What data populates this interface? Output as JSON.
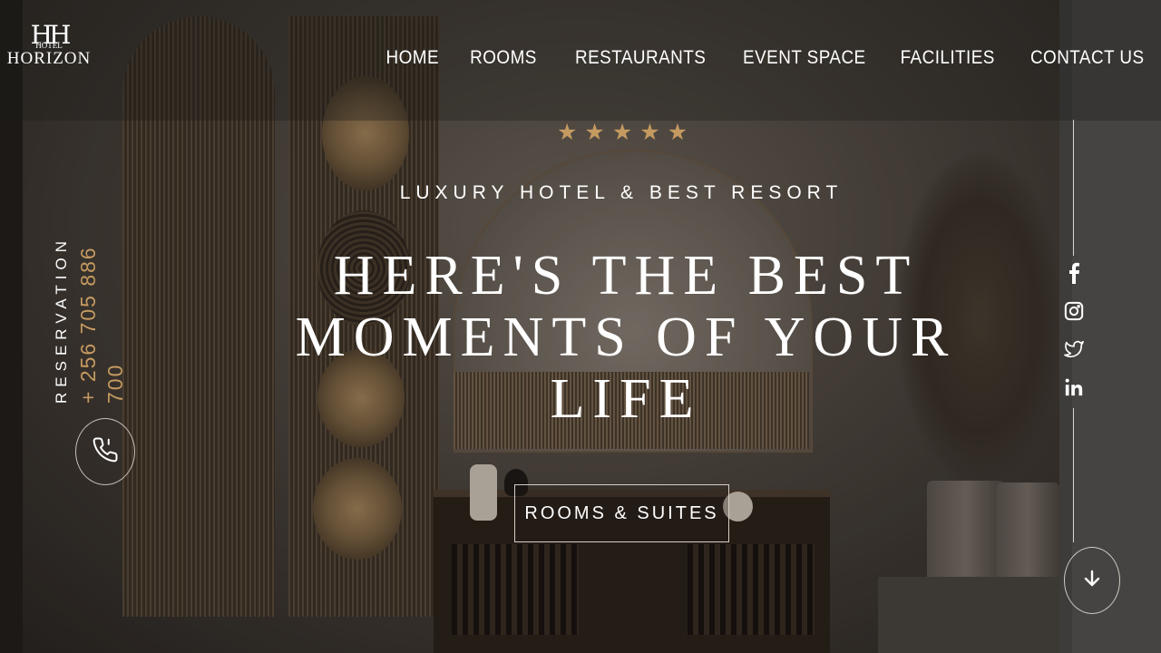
{
  "brand": {
    "mark": "H",
    "small_text": "HOTEL",
    "name": "HORIZON"
  },
  "nav": {
    "items": [
      "HOME",
      "ROOMS",
      "RESTAURANTS",
      "EVENT SPACE",
      "FACILITIES",
      "CONTACT US"
    ]
  },
  "hero": {
    "stars": [
      "★",
      "★",
      "★",
      "★",
      "★"
    ],
    "star_color": "#c59a61",
    "tagline": "LUXURY HOTEL & BEST RESORT",
    "headline": "HERE'S THE BEST MOMENTS OF YOUR LIFE",
    "cta_label": "ROOMS & SUITES"
  },
  "reservation": {
    "label": "RESERVATION",
    "phone": "+ 256 705 886 700",
    "phone_icon": "phone-icon"
  },
  "social": {
    "icons": [
      "facebook-icon",
      "instagram-icon",
      "twitter-icon",
      "linkedin-icon"
    ]
  },
  "scroll": {
    "icon": "arrow-down-icon"
  },
  "colors": {
    "accent": "#c59a61",
    "text": "#ffffff"
  }
}
